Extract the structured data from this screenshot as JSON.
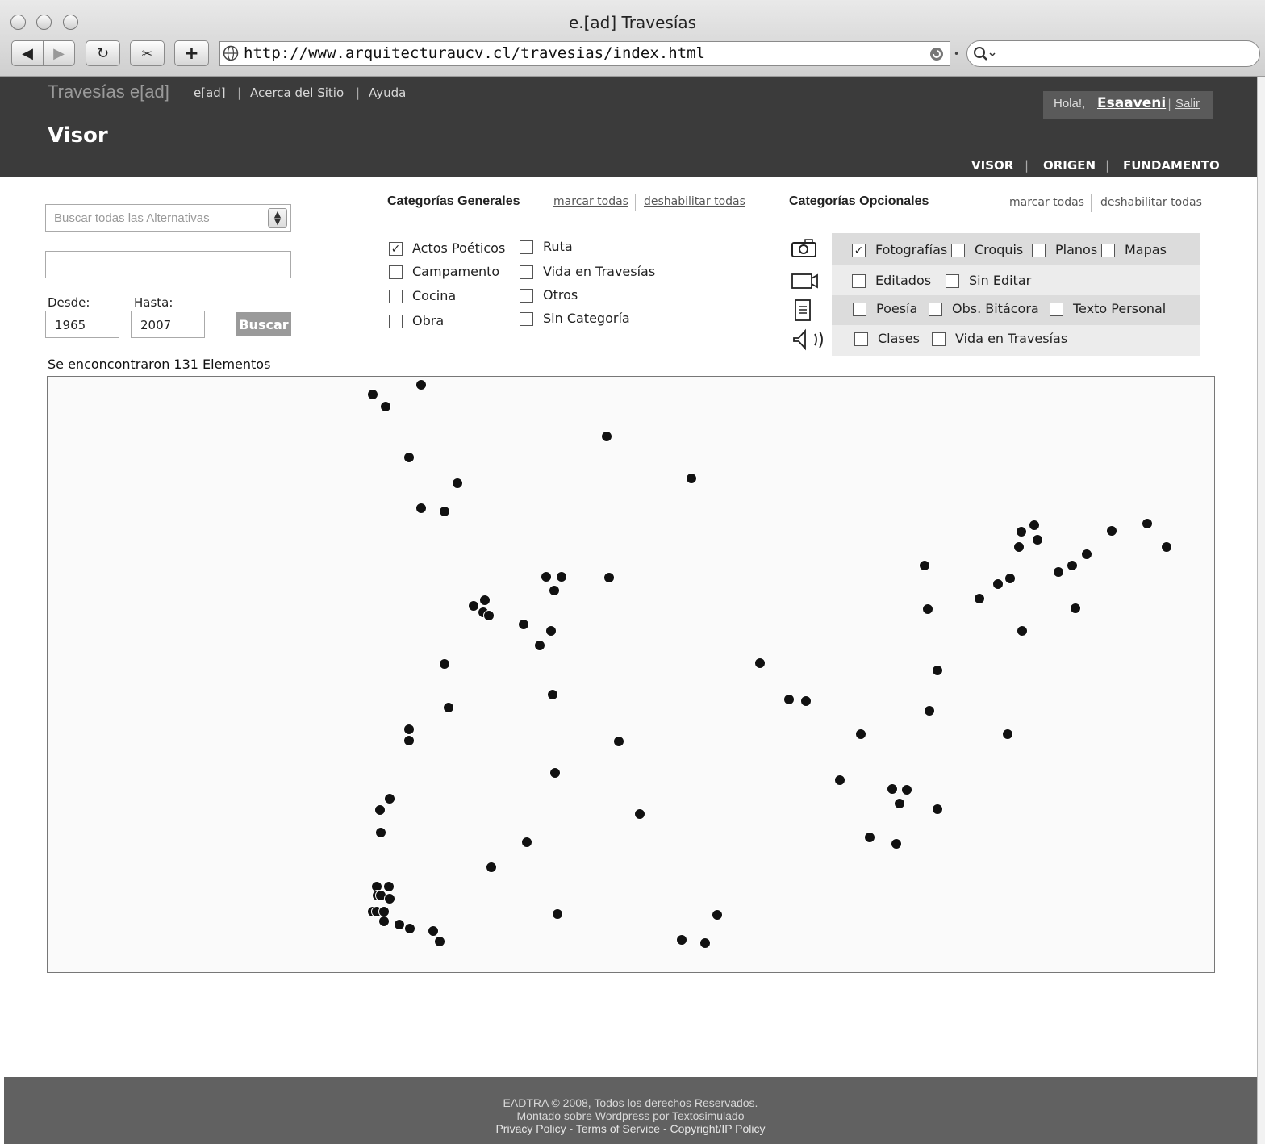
{
  "browser": {
    "window_title": "e.[ad] Travesías",
    "url": "http://www.arquitecturaucv.cl/travesias/index.html",
    "search_icon": "magnifier-icon"
  },
  "site": {
    "title": "Travesías e[ad]",
    "top_links": [
      "e[ad]",
      "Acerca del Sitio",
      "Ayuda"
    ],
    "page_title": "Visor",
    "greeting": "Hola!,",
    "username": "Esaaveni",
    "logout": "Salir",
    "main_nav": [
      "VISOR",
      "ORIGEN",
      "FUNDAMENTO"
    ]
  },
  "search": {
    "select_placeholder": "Buscar todas las Alternativas",
    "text_value": "",
    "desde_label": "Desde:",
    "hasta_label": "Hasta:",
    "desde_value": "1965",
    "hasta_value": "2007",
    "button": "Buscar",
    "result_text": "Se enconcontraron 131 Elementos"
  },
  "general_categories": {
    "title": "Categorías Generales",
    "mark_all": "marcar todas",
    "disable_all": "deshabilitar todas",
    "col1": [
      {
        "label": "Actos Poéticos",
        "checked": true
      },
      {
        "label": "Campamento",
        "checked": false
      },
      {
        "label": "Cocina",
        "checked": false
      },
      {
        "label": "Obra",
        "checked": false
      }
    ],
    "col2": [
      {
        "label": "Ruta",
        "checked": false
      },
      {
        "label": "Vida en Travesías",
        "checked": false
      },
      {
        "label": "Otros",
        "checked": false
      },
      {
        "label": "Sin Categoría",
        "checked": false
      }
    ]
  },
  "optional_categories": {
    "title": "Categorías Opcionales",
    "mark_all": "marcar todas",
    "disable_all": "deshabilitar todas",
    "rows": [
      {
        "icon": "camera-icon",
        "items": [
          {
            "label": "Fotografías",
            "checked": true
          },
          {
            "label": "Croquis",
            "checked": false
          },
          {
            "label": "Planos",
            "checked": false
          },
          {
            "label": "Mapas",
            "checked": false
          }
        ]
      },
      {
        "icon": "video-camera-icon",
        "items": [
          {
            "label": "Editados",
            "checked": false
          },
          {
            "label": "Sin Editar",
            "checked": false
          }
        ]
      },
      {
        "icon": "document-icon",
        "items": [
          {
            "label": "Poesía",
            "checked": false
          },
          {
            "label": "Obs. Bitácora",
            "checked": false
          },
          {
            "label": "Texto Personal",
            "checked": false
          }
        ]
      },
      {
        "icon": "speaker-icon",
        "items": [
          {
            "label": "Clases",
            "checked": false
          },
          {
            "label": "Vida en Travesías",
            "checked": false
          }
        ]
      }
    ]
  },
  "footer": {
    "line1": "EADTRA © 2008, Todos los derechos Reservados.",
    "line2": "Montado sobre Wordpress por Textosimulado",
    "privacy": "Privacy Policy ",
    "terms": "Terms of Service",
    "copyright": "Copyright/IP Policy",
    "dash": "-"
  }
}
